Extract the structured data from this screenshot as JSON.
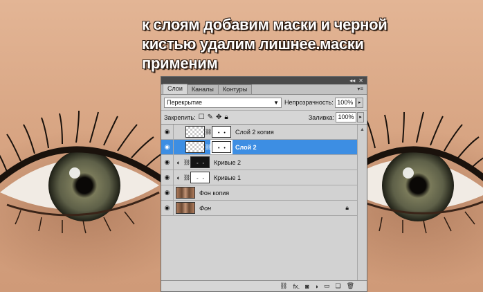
{
  "caption": {
    "line1": "к слоям добавим маски и черной",
    "line2": "кистью удалим лишнее.маски",
    "line3": "применим"
  },
  "panel": {
    "titlebar": {
      "collapse_icon": "double-chevron-icon",
      "collapse_glyph": "◂◂",
      "close_glyph": "✕"
    },
    "tabs": [
      {
        "label": "Слои",
        "active": true
      },
      {
        "label": "Каналы",
        "active": false
      },
      {
        "label": "Контуры",
        "active": false
      }
    ],
    "menu_glyph": "▾≡",
    "blend_mode": "Перекрытие",
    "opacity_label": "Непрозрачность:",
    "opacity_value": "100%",
    "lock_label": "Закрепить:",
    "fill_label": "Заливка:",
    "fill_value": "100%",
    "layers": [
      {
        "name": "Слой 2 копия",
        "visible": true,
        "selected": false,
        "thumb": "checker",
        "mask": "white"
      },
      {
        "name": "Слой 2",
        "visible": true,
        "selected": true,
        "thumb": "checker",
        "mask": "white"
      },
      {
        "name": "Кривые 2",
        "visible": true,
        "selected": false,
        "thumb": "adjustment",
        "mask": "dark"
      },
      {
        "name": "Кривые 1",
        "visible": true,
        "selected": false,
        "thumb": "adjustment",
        "mask": "white"
      },
      {
        "name": "Фон копия",
        "visible": true,
        "selected": false,
        "thumb": "photo",
        "mask": "none"
      },
      {
        "name": "Фон",
        "visible": true,
        "selected": false,
        "thumb": "photo",
        "mask": "none",
        "locked": true
      }
    ],
    "bottom_icons": [
      "link-icon",
      "fx-icon",
      "mask-icon",
      "adjustment-icon",
      "folder-icon",
      "new-layer-icon",
      "trash-icon"
    ],
    "fx_label": "fx."
  },
  "colors": {
    "selection": "#3d8ee3",
    "panel_bg": "#d6d6d6",
    "skin": "#d9a988"
  }
}
